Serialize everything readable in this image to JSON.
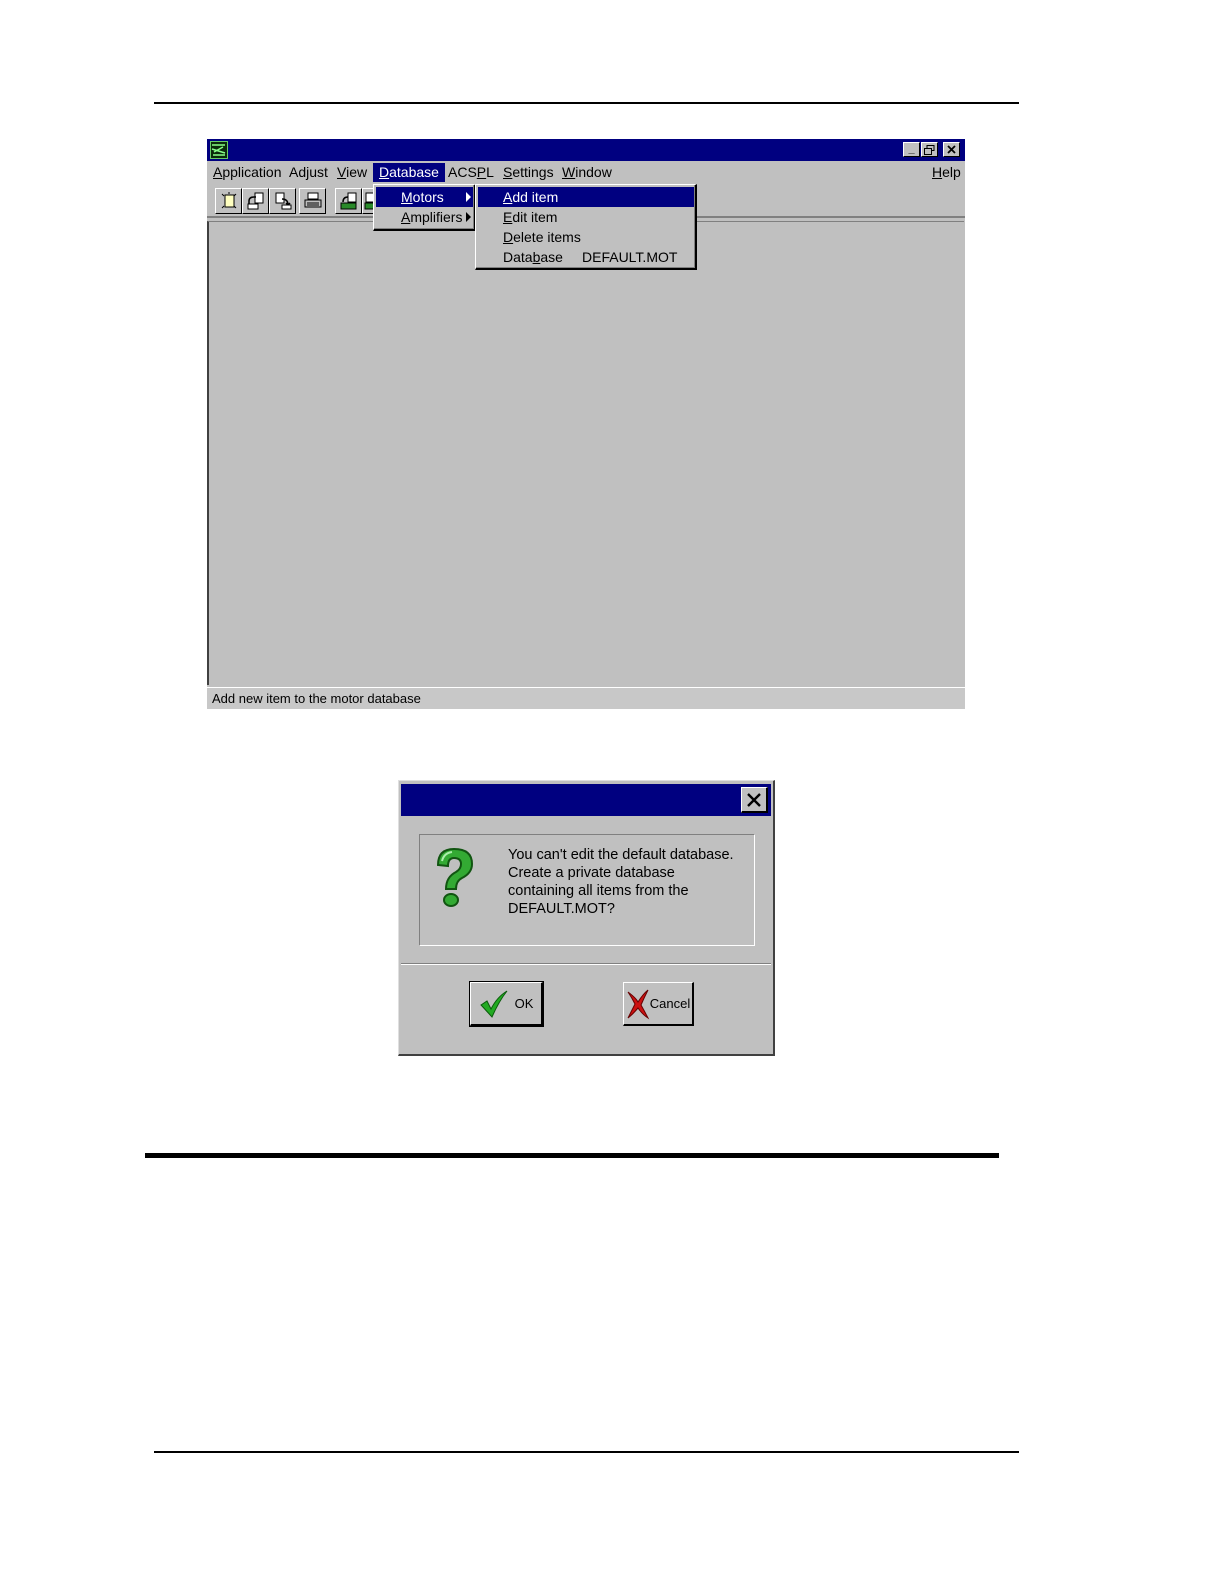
{
  "app": {
    "menubar": [
      {
        "label": "Application",
        "accel": "A",
        "rest": "pplication"
      },
      {
        "label": "Adjust",
        "pre": "Ad",
        "accel": "j",
        "rest": "ust"
      },
      {
        "label": "View",
        "accel": "V",
        "rest": "iew"
      },
      {
        "label": "Database",
        "accel": "D",
        "rest": "atabase"
      },
      {
        "label": "ACSPL",
        "pre": "ACS",
        "accel": "P",
        "rest": "L"
      },
      {
        "label": "Settings",
        "accel": "S",
        "rest": "ettings"
      },
      {
        "label": "Window",
        "accel": "W",
        "rest": "indow"
      },
      {
        "label": "Help",
        "accel": "H",
        "rest": "elp"
      }
    ],
    "database_menu": [
      {
        "label": "Motors",
        "accel": "M",
        "rest": "otors"
      },
      {
        "label": "Amplifiers",
        "accel": "A",
        "rest": "mplifiers"
      }
    ],
    "motors_menu": [
      {
        "label": "Add item",
        "accel": "A",
        "rest": "dd item"
      },
      {
        "label": "Edit item",
        "accel": "E",
        "rest": "dit item"
      },
      {
        "label": "Delete items",
        "accel": "D",
        "rest": "elete items"
      },
      {
        "label": "Database",
        "pre": "Data",
        "accel": "b",
        "rest": "ase",
        "value": "DEFAULT.MOT"
      }
    ],
    "status_text": "Add new item to the motor database"
  },
  "dialog": {
    "message_lines": [
      "You can't edit the default database.",
      "Create a private database",
      "containing all items from the",
      "DEFAULT.MOT?"
    ],
    "ok_label": "OK",
    "cancel_label": "Cancel"
  },
  "colors": {
    "titlebar": "#000080",
    "face": "#c0c0c0",
    "ok_check": "#22aa22",
    "cancel_x": "#cc1111",
    "question_mark": "#33aa33"
  }
}
